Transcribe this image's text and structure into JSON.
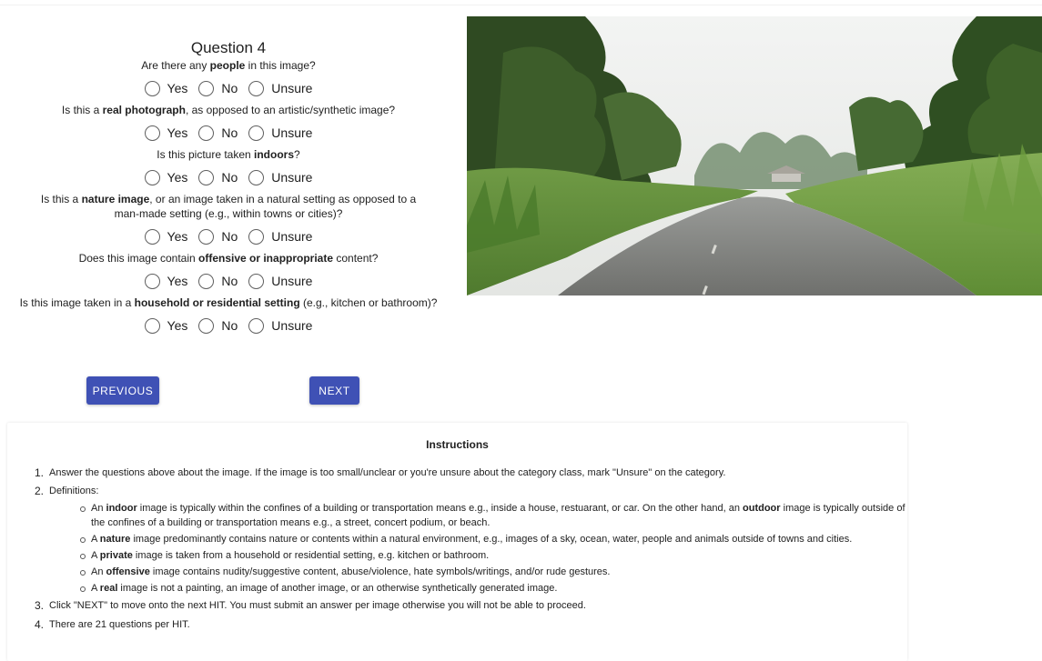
{
  "question": {
    "title": "Question 4",
    "items": [
      {
        "pre": "Are there any ",
        "bold": "people",
        "post": " in this image?"
      },
      {
        "pre": "Is this a ",
        "bold": "real photograph",
        "post": ", as opposed to an artistic/synthetic image?"
      },
      {
        "pre": "Is this picture taken ",
        "bold": "indoors",
        "post": "?"
      },
      {
        "pre": "Is this a ",
        "bold": "nature image",
        "post": ", or an image taken in a natural setting as opposed to a man-made setting (e.g., within towns or cities)?"
      },
      {
        "pre": "Does this image contain ",
        "bold": "offensive or inappropriate",
        "post": " content?"
      },
      {
        "pre": "Is this image taken in a ",
        "bold": "household or residential setting",
        "post": " (e.g., kitchen or bathroom)?"
      }
    ],
    "options": [
      "Yes",
      "No",
      "Unsure"
    ]
  },
  "buttons": {
    "previous": "PREVIOUS",
    "next": "NEXT"
  },
  "instructions": {
    "title": "Instructions",
    "step1": "Answer the questions above about the image. If the image is too small/unclear or you're unsure about the category class, mark \"Unsure\" on the category.",
    "step2": "Definitions:",
    "definitions": [
      {
        "a": "An ",
        "b": "indoor",
        "c": " image is typically within the confines of a building or transportation means e.g., inside a house, restuarant, or car. On the other hand, an ",
        "d": "outdoor",
        "e": " image is typically outside of the confines of a building or transportation means e.g., a street, concert podium, or beach."
      },
      {
        "a": "A ",
        "b": "nature",
        "c": " image predominantly contains nature or contents within a natural environment, e.g., images of a sky, ocean, water, people and animals outside of towns and cities.",
        "d": "",
        "e": ""
      },
      {
        "a": "A ",
        "b": "private",
        "c": " image is taken from a household or residential setting, e.g. kitchen or bathroom.",
        "d": "",
        "e": ""
      },
      {
        "a": "An ",
        "b": "offensive",
        "c": " image contains nudity/suggestive content, abuse/violence, hate symbols/writings, and/or rude gestures.",
        "d": "",
        "e": ""
      },
      {
        "a": "A ",
        "b": "real",
        "c": " image is not a painting, an image of another image, or an otherwise synthetically generated image.",
        "d": "",
        "e": ""
      }
    ],
    "step3": "Click \"NEXT\" to move onto the next HIT. You must submit an answer per image otherwise you will not be able to proceed.",
    "step4": "There are 21 questions per HIT.",
    "numbers": [
      "1.",
      "2.",
      "3.",
      "4."
    ]
  },
  "colors": {
    "button": "#3f51b5",
    "radio_border": "#5f5f5f"
  }
}
